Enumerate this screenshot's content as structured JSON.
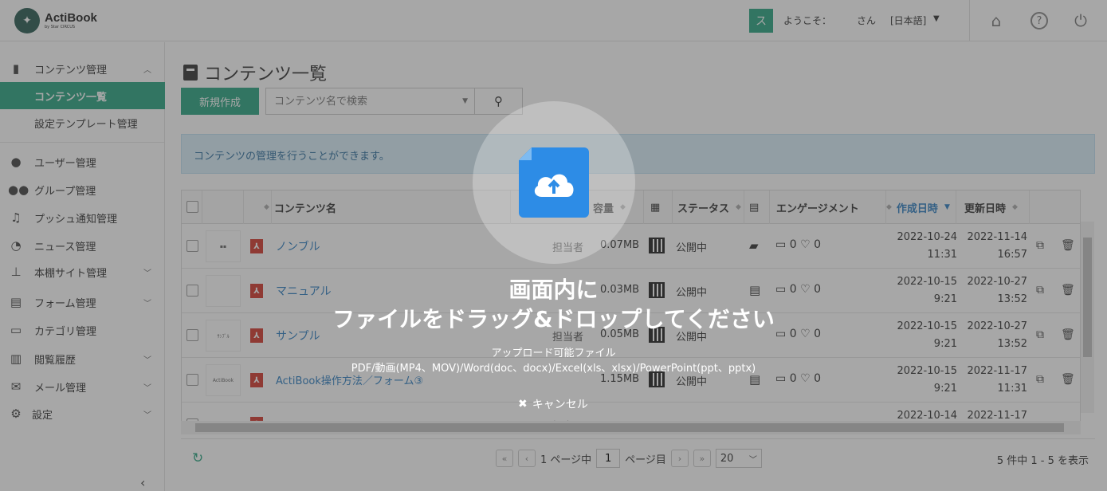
{
  "header": {
    "logo_name": "ActiBook",
    "logo_sub": "by Star CIRCUS",
    "user_icon": "ス",
    "welcome": "ようこそ：",
    "user_suffix": "さん",
    "language": "[日本語]"
  },
  "sidebar": {
    "items": [
      {
        "label": "コンテンツ管理",
        "icon": "book-icon"
      },
      {
        "label": "コンテンツ一覧"
      },
      {
        "label": "設定テンプレート管理"
      },
      {
        "label": "ユーザー管理",
        "icon": "user-icon"
      },
      {
        "label": "グループ管理",
        "icon": "group-icon"
      },
      {
        "label": "プッシュ通知管理",
        "icon": "bell-icon"
      },
      {
        "label": "ニュース管理",
        "icon": "rss-icon"
      },
      {
        "label": "本棚サイト管理",
        "icon": "sitemap-icon"
      },
      {
        "label": "フォーム管理",
        "icon": "form-icon"
      },
      {
        "label": "カテゴリ管理",
        "icon": "folder-icon"
      },
      {
        "label": "閲覧履歴",
        "icon": "bar-chart-icon"
      },
      {
        "label": "メール管理",
        "icon": "mail-icon"
      },
      {
        "label": "設定",
        "icon": "gear-icon"
      }
    ]
  },
  "main": {
    "title": "コンテンツ一覧",
    "new_button": "新規作成",
    "search_placeholder": "コンテンツ名で検索",
    "info": "コンテンツの管理を行うことができます。",
    "columns": {
      "name": "コンテンツ名",
      "capacity": "容量",
      "status": "ステータス",
      "engagement": "エンゲージメント",
      "created": "作成日時",
      "updated": "更新日時"
    },
    "rows": [
      {
        "thumb": "▪▪",
        "name": "ノンブル",
        "owner": "担当者",
        "size": "0.07MB",
        "status": "公開中",
        "comments": "0",
        "likes": "0",
        "created_date": "2022-10-24",
        "created_time": "11:31",
        "updated_date": "2022-11-14",
        "updated_time": "16:57"
      },
      {
        "thumb": "",
        "name": "マニュアル",
        "owner": "",
        "size": "0.03MB",
        "status": "公開中",
        "comments": "0",
        "likes": "0",
        "created_date": "2022-10-15",
        "created_time": "9:21",
        "updated_date": "2022-10-27",
        "updated_time": "13:52"
      },
      {
        "thumb": "ｻﾝﾌﾟﾙ",
        "name": "サンプル",
        "owner": "担当者",
        "size": "0.05MB",
        "status": "公開中",
        "comments": "0",
        "likes": "0",
        "created_date": "2022-10-15",
        "created_time": "9:21",
        "updated_date": "2022-10-27",
        "updated_time": "13:52"
      },
      {
        "thumb": "ActiBook",
        "name": "ActiBook操作方法／フォーム③",
        "owner": "",
        "size": "1.15MB",
        "status": "公開中",
        "comments": "0",
        "likes": "0",
        "created_date": "2022-10-15",
        "created_time": "9:21",
        "updated_date": "2022-11-17",
        "updated_time": "11:31"
      },
      {
        "thumb": "",
        "name": "",
        "owner": "担当者",
        "size": "",
        "status": "",
        "comments": "",
        "likes": "",
        "created_date": "2022-10-14",
        "created_time": "",
        "updated_date": "2022-11-17",
        "updated_time": ""
      }
    ],
    "pager": {
      "page_prefix": "1 ページ中",
      "current_page": "1",
      "page_suffix": "ページ目",
      "per_page": "20",
      "count": "5 件中 1 - 5 を表示"
    }
  },
  "overlay": {
    "title_line1": "画面内に",
    "title_line2": "ファイルをドラッグ&ドロップしてください",
    "uploadable_label": "アップロード可能ファイル",
    "file_types": "PDF/動画(MP4、MOV)/Word(doc、docx)/Excel(xls、xlsx)/PowerPoint(ppt、pptx)",
    "cancel": "キャンセル"
  }
}
